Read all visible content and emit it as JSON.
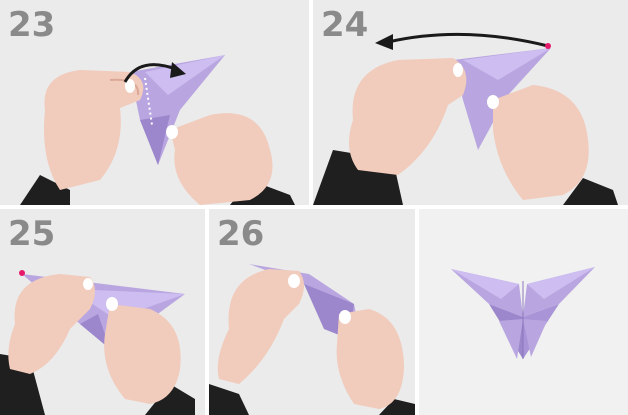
{
  "steps": [
    {
      "number": "23"
    },
    {
      "number": "24"
    },
    {
      "number": "25"
    },
    {
      "number": "26"
    }
  ],
  "colors": {
    "paper": "#b9a6e0",
    "paper_shadow": "#9c86cc",
    "paper_light": "#cdbdf0",
    "skin": "#f1cbbb",
    "skin_shadow": "#dba898",
    "sleeve": "#1f1f1f",
    "marker": "#e6196b",
    "number": "#8a8a8a",
    "panel_bg": "#ebebeb"
  }
}
